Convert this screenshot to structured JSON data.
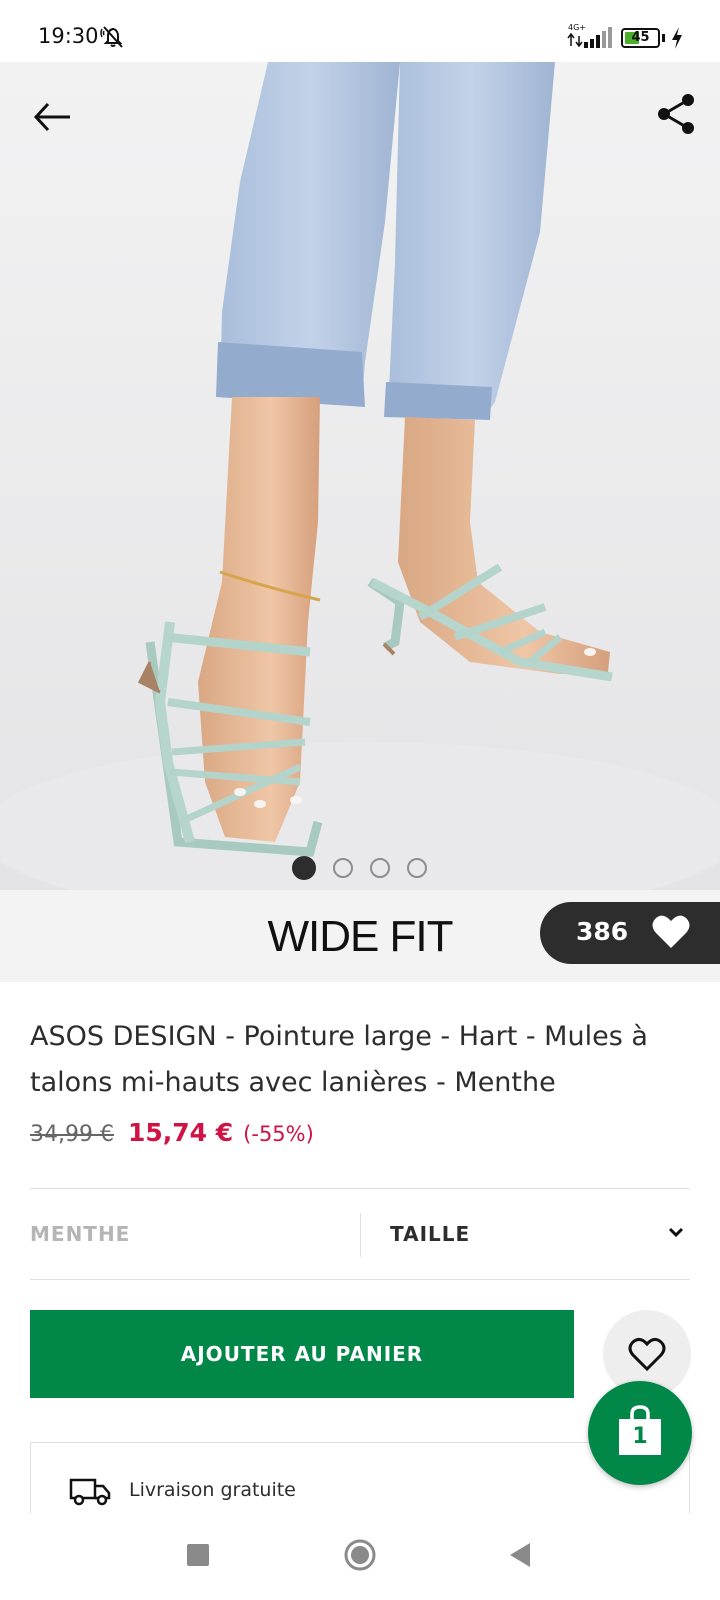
{
  "status_bar": {
    "time": "19:30",
    "network": "4G+",
    "battery": "45",
    "battery_level": 0.45
  },
  "hero": {
    "image_count": 4,
    "active_index": 0
  },
  "banner": {
    "fit_label": "WIDE FIT",
    "save_count": "386"
  },
  "product": {
    "title": "ASOS DESIGN - Pointure large - Hart - Mules à talons mi-hauts avec lanières - Menthe",
    "old_price": "34,99 €",
    "new_price": "15,74 €",
    "discount": "(-55%)"
  },
  "selectors": {
    "colour": "MENTHE",
    "size_label": "TAILLE"
  },
  "actions": {
    "add_to_bag": "AJOUTER AU PANIER",
    "bag_count": "1"
  },
  "delivery": {
    "label": "Livraison gratuite"
  },
  "colors": {
    "primary_green": "#018849",
    "sale_red": "#d01345",
    "dark": "#2d2d2d"
  }
}
